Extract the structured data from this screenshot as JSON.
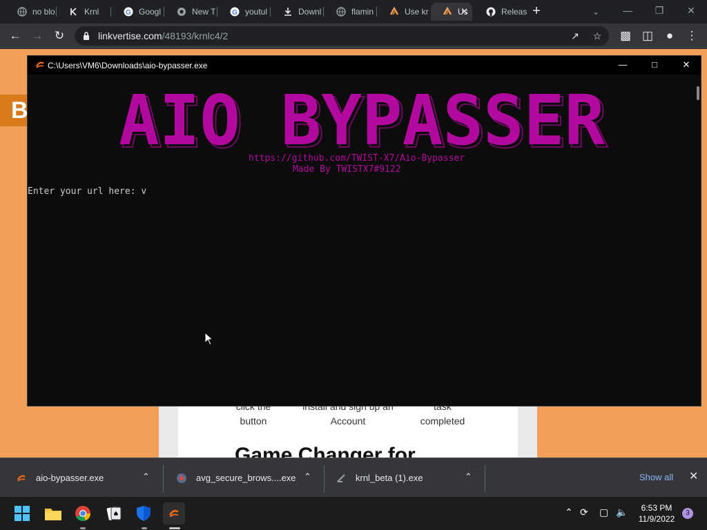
{
  "browser": {
    "tabs": [
      {
        "label": "no blo",
        "icon": "globe-icon"
      },
      {
        "label": "Krnl",
        "icon": "krnl-icon"
      },
      {
        "label": "Googl",
        "icon": "google-icon"
      },
      {
        "label": "New T",
        "icon": "chrome-icon"
      },
      {
        "label": "youtul",
        "icon": "google-icon"
      },
      {
        "label": "Downl",
        "icon": "download-icon"
      },
      {
        "label": "flamin",
        "icon": "globe-icon"
      },
      {
        "label": "Use kr",
        "icon": "linkvertise-icon"
      },
      {
        "label": "Us",
        "icon": "linkvertise-icon",
        "active": true
      },
      {
        "label": "Releas",
        "icon": "github-icon"
      }
    ],
    "url_domain": "linkvertise.com",
    "url_path": "/48193/krnlc4/2"
  },
  "page": {
    "banner_letter": "B",
    "steps": [
      {
        "text": "click the\nbutton"
      },
      {
        "text": "install and sign up an\nAccount"
      },
      {
        "text": "task\ncompleted"
      }
    ],
    "big_heading": "Game Changer for"
  },
  "console": {
    "title": "C:\\Users\\VM6\\Downloads\\aio-bypasser.exe",
    "ascii_title": "AIO BYPASSER",
    "link": "https://github.com/TWIST-X7/Aio-Bypasser",
    "credit": "Made By TWISTX7#9122",
    "prompt": "Enter your url here: v",
    "colors": {
      "magenta": "#b3099f",
      "shadow": "#6e0a62",
      "text": "#cccccc",
      "bg": "#0c0c0c"
    }
  },
  "downloads": {
    "items": [
      {
        "name": "aio-bypasser.exe",
        "icon": "aio-bypasser-icon"
      },
      {
        "name": "avg_secure_brows....exe",
        "icon": "avg-icon"
      },
      {
        "name": "krnl_beta (1).exe",
        "icon": "krnl-icon"
      }
    ],
    "show_all": "Show all"
  },
  "taskbar": {
    "time": "6:53 PM",
    "date": "11/9/2022",
    "notification_count": "3"
  }
}
